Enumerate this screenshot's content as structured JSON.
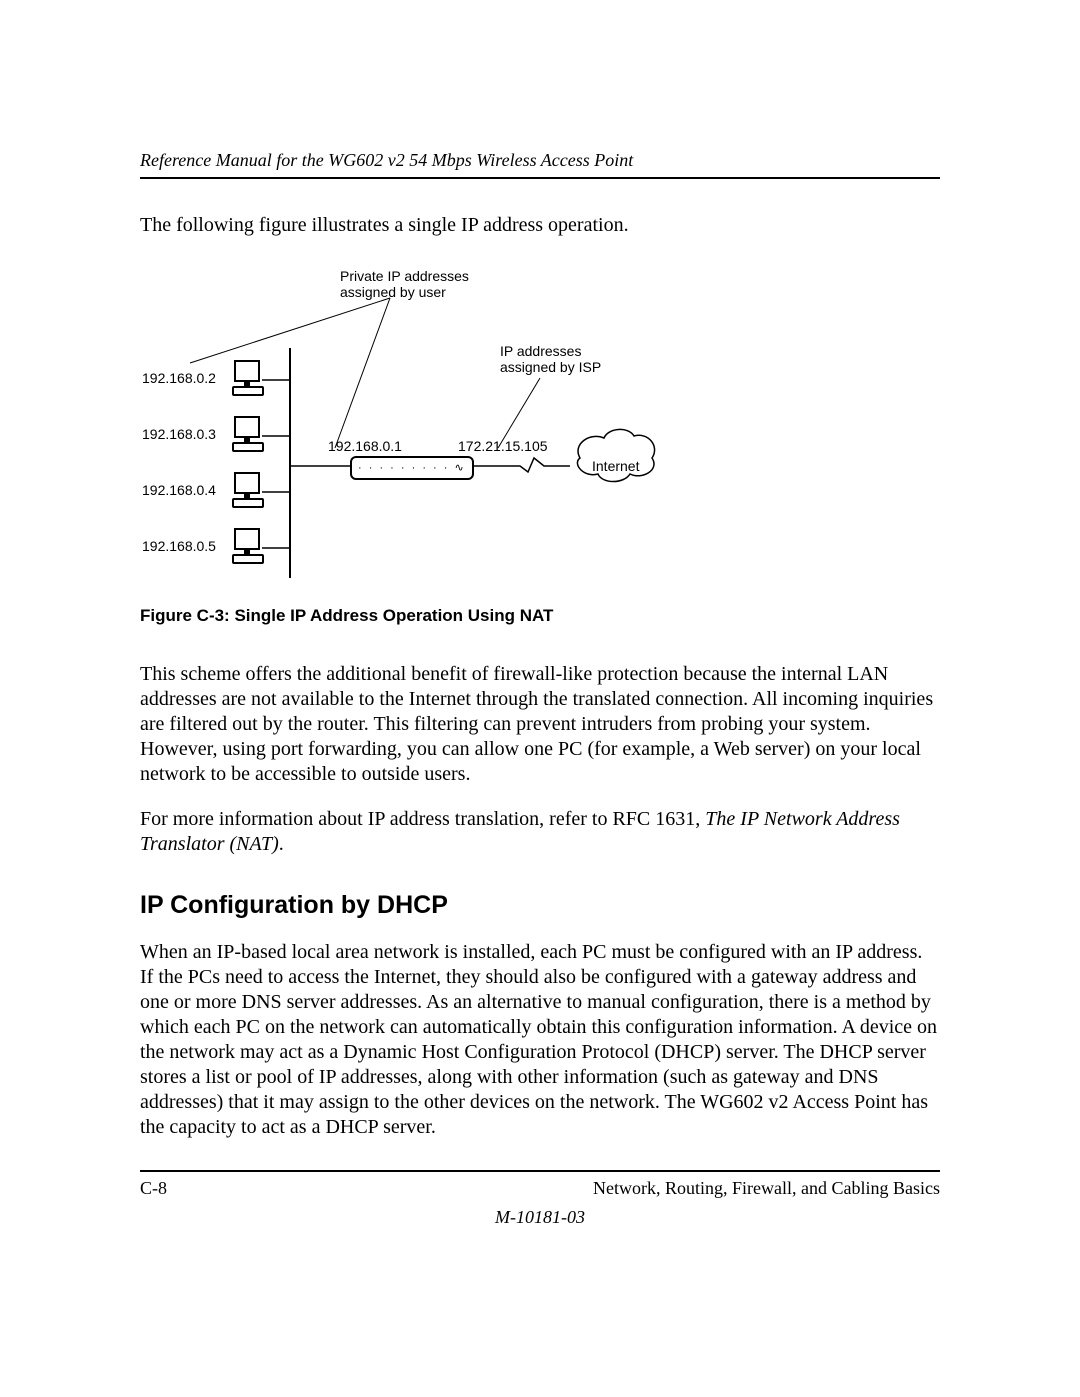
{
  "header": {
    "running_title": "Reference Manual for the WG602 v2 54 Mbps Wireless Access Point"
  },
  "intro_text": "The following figure illustrates a single IP address operation.",
  "diagram": {
    "private_label_l1": "Private IP addresses",
    "private_label_l2": "assigned by user",
    "isp_label_l1": "IP addresses",
    "isp_label_l2": "assigned by ISP",
    "pc_ips": [
      "192.168.0.2",
      "192.168.0.3",
      "192.168.0.4",
      "192.168.0.5"
    ],
    "router_lan_ip": "192.168.0.1",
    "router_wan_ip": "172.21.15.105",
    "internet_label": "Internet"
  },
  "figure_caption": "Figure C-3:  Single IP Address Operation Using NAT",
  "para_firewall": "This scheme offers the additional benefit of firewall-like protection because the internal LAN addresses are not available to the Internet through the translated connection. All incoming inquiries are filtered out by the router. This filtering can prevent intruders from probing your system. However, using port forwarding, you can allow one PC (for example, a Web server) on your local network to be accessible to outside users.",
  "para_rfc_lead": "For more information about IP address translation, refer to RFC 1631, ",
  "para_rfc_ital": "The IP Network Address Translator (NAT)",
  "para_rfc_tail": ".",
  "section_heading": "IP Configuration by DHCP",
  "para_dhcp": "When an IP-based local area network is installed, each PC must be configured with an IP address. If the PCs need to access the Internet, they should also be configured with a gateway address and one or more DNS server addresses. As an alternative to manual configuration, there is a method by which each PC on the network can automatically obtain this configuration information. A device on the network may act as a Dynamic Host Configuration Protocol (DHCP) server. The DHCP server stores a list or pool of IP addresses, along with other information (such as gateway and DNS addresses) that it may assign to the other devices on the network. The WG602 v2 Access Point has the capacity to act as a DHCP server.",
  "footer": {
    "page_number": "C-8",
    "section_title": "Network, Routing, Firewall, and Cabling Basics",
    "doc_number": "M-10181-03"
  }
}
